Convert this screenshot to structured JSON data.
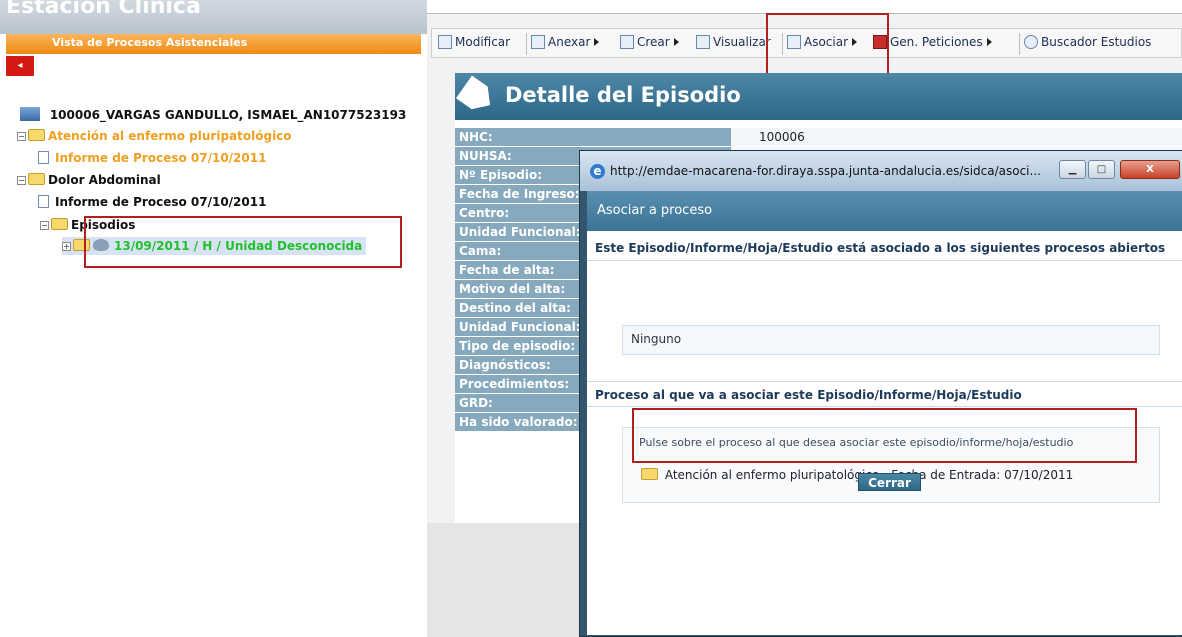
{
  "app": {
    "title": "Estación Clínica",
    "subtitle": "Vista de Procesos Asistenciales",
    "collapse_glyph": "◂"
  },
  "tree": {
    "patient": "100006_VARGAS GANDULLO, ISMAEL_AN1077523193",
    "process1": "Atención al enfermo pluripatológico",
    "process1_report": "Informe de Proceso 07/10/2011",
    "process2": "Dolor Abdominal",
    "process2_report": "Informe de Proceso 07/10/2011",
    "episodes_folder": "Episodios",
    "episode": "13/09/2011 / H / Unidad Desconocida"
  },
  "toolbar": {
    "modificar": "Modificar",
    "anexar": "Anexar",
    "crear": "Crear",
    "visualizar": "Visualizar",
    "asociar": "Asociar",
    "gen_peticiones": "Gen. Peticiones",
    "buscador": "Buscador Estudios"
  },
  "detail": {
    "title": "Detalle del Episodio",
    "rows": [
      {
        "label": "NHC:",
        "value": "100006"
      },
      {
        "label": "NUHSA:",
        "value": ""
      },
      {
        "label": "Nº Episodio:",
        "value": ""
      },
      {
        "label": "Fecha de Ingreso:",
        "value": ""
      },
      {
        "label": "Centro:",
        "value": ""
      },
      {
        "label": "Unidad Funcional:",
        "value": ""
      },
      {
        "label": "Cama:",
        "value": ""
      },
      {
        "label": "Fecha de alta:",
        "value": ""
      },
      {
        "label": "Motivo del alta:",
        "value": ""
      },
      {
        "label": "Destino del alta:",
        "value": ""
      },
      {
        "label": "Unidad Funcional:",
        "value": ""
      },
      {
        "label": "Tipo de episodio:",
        "value": ""
      },
      {
        "label": "Diagnósticos:",
        "value": ""
      },
      {
        "label": "Procedimientos:",
        "value": ""
      },
      {
        "label": "GRD:",
        "value": ""
      },
      {
        "label": "Ha sido valorado:",
        "value": ""
      }
    ]
  },
  "popup": {
    "url": "http://emdae-macarena-for.diraya.sspa.junta-andalucia.es/sidca/asoci...",
    "heading": "Asociar a proceso",
    "section1_title": "Este Episodio/Informe/Hoja/Estudio está asociado a los siguientes procesos abiertos",
    "section1_value": "Ninguno",
    "section2_title": "Proceso al que va a asociar este Episodio/Informe/Hoja/Estudio",
    "instruction": "Pulse sobre el proceso al que desea asociar este episodio/informe/hoja/estudio",
    "process_option": "Atención al enfermo pluripatológico - Fecha de Entrada: 07/10/2011",
    "close_button": "Cerrar",
    "win_minimize": "▁",
    "win_maximize": "□",
    "win_close": "X"
  },
  "colors": {
    "orange": "#f0a020",
    "green": "#21c12a",
    "header_blue": "#2d6888",
    "highlight_red": "#b21f1f"
  }
}
